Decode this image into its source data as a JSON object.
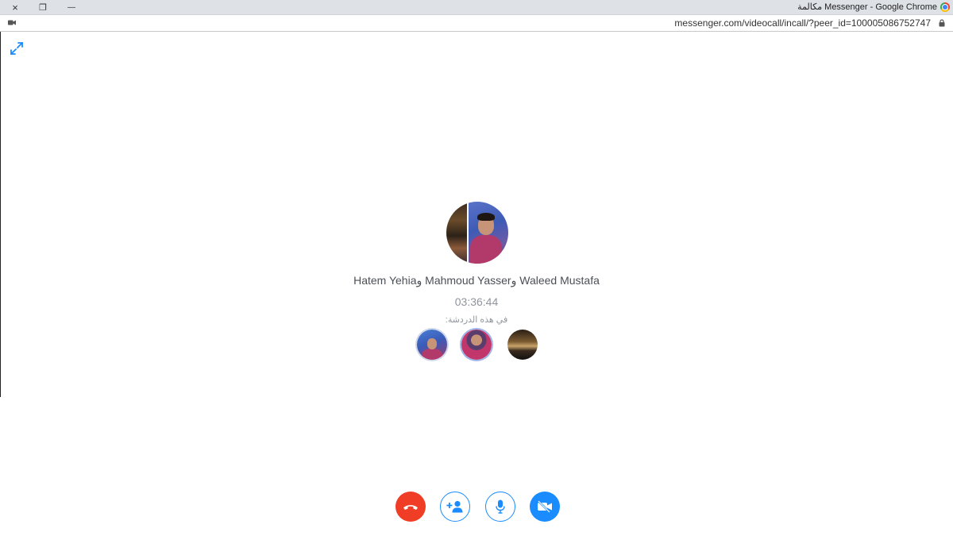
{
  "window": {
    "title": "Messenger - Google Chrome مكالمة",
    "close_icon": "×",
    "restore_icon": "❐",
    "minimize_icon": "—"
  },
  "address_bar": {
    "url": "messenger.com/videocall/incall/?peer_id=100005086752747"
  },
  "call": {
    "participants_names": "Hatem Yehiaو Mahmoud Yasserو Waleed Mustafa",
    "duration": "03:36:44",
    "in_chat_label": "في هذه الدردشة:"
  },
  "colors": {
    "accent": "#1a8cff",
    "end_call": "#f03d25",
    "text_primary": "#4b4f56",
    "text_secondary": "#90949c"
  },
  "icons": {
    "expand": "expand-icon",
    "end_call": "phone-hangup-icon",
    "add_person": "add-person-icon",
    "mic": "microphone-icon",
    "video_off": "video-off-icon"
  }
}
